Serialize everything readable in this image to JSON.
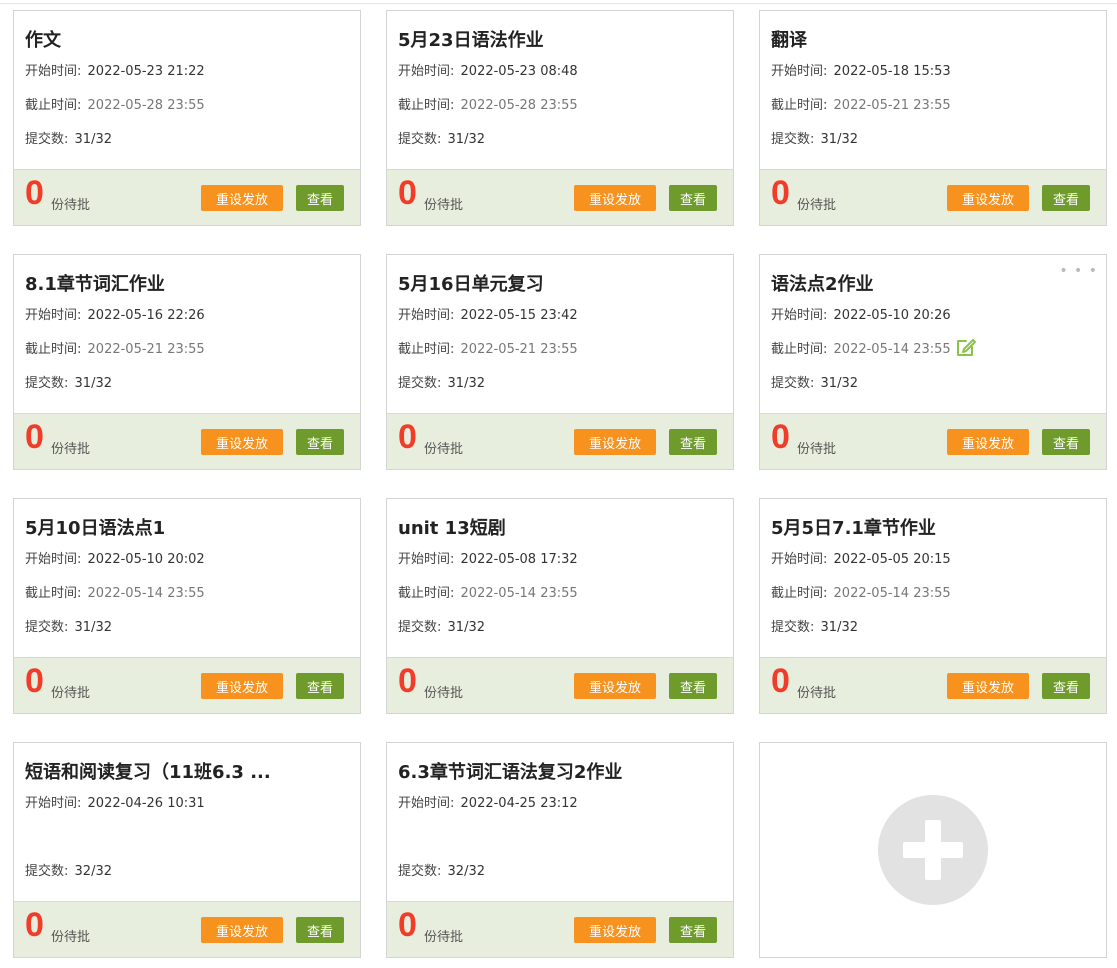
{
  "labels": {
    "start": "开始时间:",
    "deadline": "截止时间:",
    "submitted": "提交数:",
    "pending_suffix": "份待批",
    "reset_button": "重设发放",
    "view_button": "查看"
  },
  "assignments": [
    {
      "title": "作文",
      "start": "2022-05-23 21:22",
      "deadline": "2022-05-28 23:55",
      "submitted": "31/32",
      "pending": "0"
    },
    {
      "title": "5月23日语法作业",
      "start": "2022-05-23 08:48",
      "deadline": "2022-05-28 23:55",
      "submitted": "31/32",
      "pending": "0"
    },
    {
      "title": "翻译",
      "start": "2022-05-18 15:53",
      "deadline": "2022-05-21 23:55",
      "submitted": "31/32",
      "pending": "0"
    },
    {
      "title": "8.1章节词汇作业",
      "start": "2022-05-16 22:26",
      "deadline": "2022-05-21 23:55",
      "submitted": "31/32",
      "pending": "0"
    },
    {
      "title": "5月16日单元复习",
      "start": "2022-05-15 23:42",
      "deadline": "2022-05-21 23:55",
      "submitted": "31/32",
      "pending": "0"
    },
    {
      "title": "语法点2作业",
      "start": "2022-05-10 20:26",
      "deadline": "2022-05-14 23:55",
      "submitted": "31/32",
      "pending": "0"
    },
    {
      "title": "5月10日语法点1",
      "start": "2022-05-10 20:02",
      "deadline": "2022-05-14 23:55",
      "submitted": "31/32",
      "pending": "0"
    },
    {
      "title": "unit 13短剧",
      "start": "2022-05-08 17:32",
      "deadline": "2022-05-14 23:55",
      "submitted": "31/32",
      "pending": "0"
    },
    {
      "title": "5月5日7.1章节作业",
      "start": "2022-05-05 20:15",
      "deadline": "2022-05-14 23:55",
      "submitted": "31/32",
      "pending": "0"
    },
    {
      "title": "短语和阅读复习（11班6.3 ...",
      "start": "2022-04-26 10:31",
      "deadline": "",
      "submitted": "32/32",
      "pending": "0"
    },
    {
      "title": "6.3章节词汇语法复习2作业",
      "start": "2022-04-25 23:12",
      "deadline": "",
      "submitted": "32/32",
      "pending": "0"
    }
  ],
  "icons": {
    "more": "more-dots-icon",
    "edit": "edit-icon",
    "add": "add-plus-icon"
  },
  "colors": {
    "pending_number": "#f03c28",
    "reset_button": "#f7921e",
    "view_button": "#6e9b2b",
    "footer_bg": "#e8eedd",
    "edit_icon": "#8bc34a"
  }
}
